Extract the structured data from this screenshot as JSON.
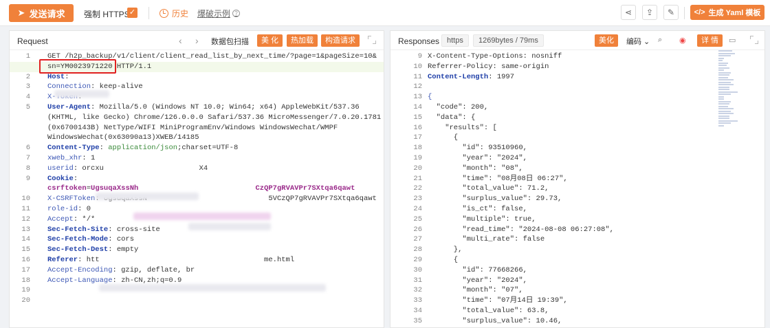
{
  "toolbar": {
    "send_label": "发送请求",
    "force_https_label": "强制 HTTPS",
    "history_label": "历史",
    "examples_label": "爆破示例",
    "yaml_label": "生成 Yaml 模板"
  },
  "request": {
    "title": "Request",
    "scan_label": "数据包扫描",
    "beautify_label": "美 化",
    "hotload_label": "热加载",
    "construct_label": "构造请求",
    "lines": [
      {
        "n": "1",
        "parts": [
          [
            "val",
            "GET /h2p_backup/v1/client/client_read_list_by_next_time/?page=1&pageSize=10&"
          ]
        ]
      },
      {
        "n": "",
        "parts": [
          [
            "val",
            "sn=YM0023971220 HTTP/1.1"
          ]
        ],
        "hl": true
      },
      {
        "n": "2",
        "parts": [
          [
            "kb",
            "Host"
          ],
          [
            "val",
            ": "
          ]
        ]
      },
      {
        "n": "3",
        "parts": [
          [
            "k",
            "Connection"
          ],
          [
            "val",
            ": keep-alive"
          ]
        ]
      },
      {
        "n": "4",
        "parts": [
          [
            "k",
            "X-Token"
          ],
          [
            "val",
            ": "
          ]
        ]
      },
      {
        "n": "5",
        "parts": [
          [
            "kb",
            "User-Agent"
          ],
          [
            "val",
            ": Mozilla/5.0 (Windows NT 10.0; Win64; x64) AppleWebKit/537.36"
          ]
        ]
      },
      {
        "n": "",
        "parts": [
          [
            "val",
            "(KHTML, like Gecko) Chrome/126.0.0.0 Safari/537.36 MicroMessenger/7.0.20.1781"
          ]
        ]
      },
      {
        "n": "",
        "parts": [
          [
            "val",
            "(0x6700143B) NetType/WIFI MiniProgramEnv/Windows WindowsWechat/WMPF"
          ]
        ]
      },
      {
        "n": "",
        "parts": [
          [
            "val",
            "WindowsWechat(0x63090a13)XWEB/14185"
          ]
        ]
      },
      {
        "n": "6",
        "parts": [
          [
            "kb",
            "Content-Type"
          ],
          [
            "val",
            ": "
          ],
          [
            "green",
            "application/json"
          ],
          [
            "val",
            ";charset=UTF-8"
          ]
        ]
      },
      {
        "n": "7",
        "parts": [
          [
            "k",
            "xweb_xhr"
          ],
          [
            "val",
            ": 1"
          ]
        ]
      },
      {
        "n": "8",
        "parts": [
          [
            "k",
            "userid"
          ],
          [
            "val",
            ": orcxu                      X4"
          ]
        ]
      },
      {
        "n": "9",
        "parts": [
          [
            "kb",
            "Cookie"
          ],
          [
            "val",
            ":"
          ]
        ]
      },
      {
        "n": "",
        "parts": [
          [
            "purple",
            "csrftoken"
          ],
          [
            "val",
            "="
          ],
          [
            "purple",
            "UgsuqaXssNh                           CzQP7gRVAVPr7SXtqa6qawt"
          ]
        ]
      },
      {
        "n": "10",
        "parts": [
          [
            "k",
            "X-CSRFToken"
          ],
          [
            "val",
            ": UgsuqaXssN                            5VCzQP7gRVAVPr7SXtqa6qawt"
          ]
        ]
      },
      {
        "n": "11",
        "parts": [
          [
            "k",
            "role-id"
          ],
          [
            "val",
            ": 0"
          ]
        ]
      },
      {
        "n": "12",
        "parts": [
          [
            "k",
            "Accept"
          ],
          [
            "val",
            ": */*"
          ]
        ]
      },
      {
        "n": "13",
        "parts": [
          [
            "kb",
            "Sec-Fetch-Site"
          ],
          [
            "val",
            ": cross-site"
          ]
        ]
      },
      {
        "n": "14",
        "parts": [
          [
            "kb",
            "Sec-Fetch-Mode"
          ],
          [
            "val",
            ": cors"
          ]
        ]
      },
      {
        "n": "15",
        "parts": [
          [
            "kb",
            "Sec-Fetch-Dest"
          ],
          [
            "val",
            ": empty"
          ]
        ]
      },
      {
        "n": "16",
        "parts": [
          [
            "kb",
            "Referer"
          ],
          [
            "val",
            ": htt                                      me.html"
          ]
        ]
      },
      {
        "n": "17",
        "parts": [
          [
            "k",
            "Accept-Encoding"
          ],
          [
            "val",
            ": gzip, deflate, br"
          ]
        ]
      },
      {
        "n": "18",
        "parts": [
          [
            "k",
            "Accept-Language"
          ],
          [
            "val",
            ": zh-CN,zh;q=0.9"
          ]
        ]
      },
      {
        "n": "19",
        "parts": []
      },
      {
        "n": "20",
        "parts": []
      }
    ]
  },
  "response": {
    "title": "Responses",
    "protocol_label": "https",
    "size_label": "1269bytes / 79ms",
    "beautify_label": "美化",
    "encoding_label": "编码",
    "detail_label": "详 情",
    "lines": [
      {
        "n": "9",
        "parts": [
          [
            "val",
            "X-Content-Type-Options: nosniff"
          ]
        ]
      },
      {
        "n": "10",
        "parts": [
          [
            "val",
            "Referrer-Policy: same-origin"
          ]
        ]
      },
      {
        "n": "11",
        "parts": [
          [
            "kb",
            "Content-Length"
          ],
          [
            "val",
            ": 1997"
          ]
        ]
      },
      {
        "n": "12",
        "parts": []
      },
      {
        "n": "13",
        "parts": [
          [
            "k",
            "{"
          ]
        ]
      },
      {
        "n": "14",
        "parts": [
          [
            "val",
            "  \"code\": 200,"
          ]
        ]
      },
      {
        "n": "15",
        "parts": [
          [
            "val",
            "  \"data\": {"
          ]
        ]
      },
      {
        "n": "16",
        "parts": [
          [
            "val",
            "    \"results\": ["
          ]
        ]
      },
      {
        "n": "17",
        "parts": [
          [
            "val",
            "      {"
          ]
        ]
      },
      {
        "n": "18",
        "parts": [
          [
            "val",
            "        \"id\": 93510960,"
          ]
        ]
      },
      {
        "n": "19",
        "parts": [
          [
            "val",
            "        \"year\": \"2024\","
          ]
        ]
      },
      {
        "n": "20",
        "parts": [
          [
            "val",
            "        \"month\": \"08\","
          ]
        ]
      },
      {
        "n": "21",
        "parts": [
          [
            "val",
            "        \"time\": \"08月08日 06:27\","
          ]
        ]
      },
      {
        "n": "22",
        "parts": [
          [
            "val",
            "        \"total_value\": 71.2,"
          ]
        ]
      },
      {
        "n": "23",
        "parts": [
          [
            "val",
            "        \"surplus_value\": 29.73,"
          ]
        ]
      },
      {
        "n": "24",
        "parts": [
          [
            "val",
            "        \"is_ct\": false,"
          ]
        ]
      },
      {
        "n": "25",
        "parts": [
          [
            "val",
            "        \"multiple\": true,"
          ]
        ]
      },
      {
        "n": "26",
        "parts": [
          [
            "val",
            "        \"read_time\": \"2024-08-08 06:27:08\","
          ]
        ]
      },
      {
        "n": "27",
        "parts": [
          [
            "val",
            "        \"multi_rate\": false"
          ]
        ]
      },
      {
        "n": "28",
        "parts": [
          [
            "val",
            "      },"
          ]
        ]
      },
      {
        "n": "29",
        "parts": [
          [
            "val",
            "      {"
          ]
        ]
      },
      {
        "n": "30",
        "parts": [
          [
            "val",
            "        \"id\": 77668266,"
          ]
        ]
      },
      {
        "n": "31",
        "parts": [
          [
            "val",
            "        \"year\": \"2024\","
          ]
        ]
      },
      {
        "n": "32",
        "parts": [
          [
            "val",
            "        \"month\": \"07\","
          ]
        ]
      },
      {
        "n": "33",
        "parts": [
          [
            "val",
            "        \"time\": \"07月14日 19:39\","
          ]
        ]
      },
      {
        "n": "34",
        "parts": [
          [
            "val",
            "        \"total_value\": 63.8,"
          ]
        ]
      },
      {
        "n": "35",
        "parts": [
          [
            "val",
            "        \"surplus_value\": 10.46,"
          ]
        ]
      }
    ]
  }
}
